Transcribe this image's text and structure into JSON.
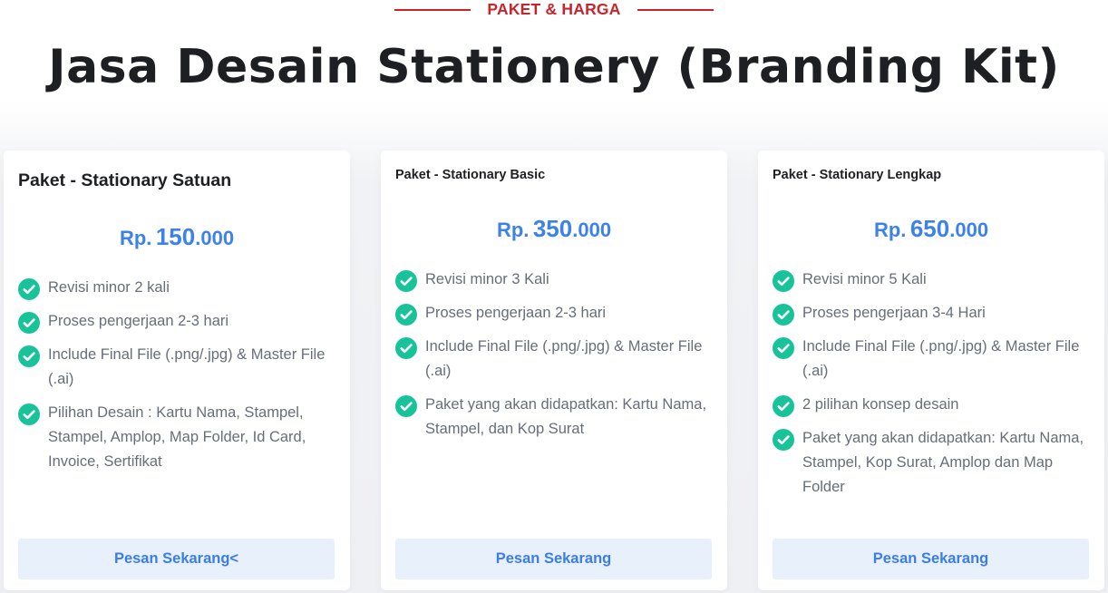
{
  "header": {
    "eyebrow": "PAKET & HARGA",
    "title": "Jasa Desain Stationery (Branding Kit)"
  },
  "colors": {
    "accent_red": "#c8252b",
    "price_blue": "#3c82ea",
    "check_green": "#19c39a",
    "button_bg": "#e8f0fc"
  },
  "icons": {
    "feature": "check-circle-icon"
  },
  "cards": [
    {
      "name": "Paket - Stationary Satuan",
      "price": {
        "currency": "Rp.",
        "main": "150",
        "tail": ".000"
      },
      "features": [
        "Revisi minor 2 kali",
        "Proses pengerjaan 2-3 hari",
        "Include Final File (.png/.jpg) & Master File (.ai)",
        "Pilihan Desain : Kartu Nama, Stampel, Stampel, Amplop, Map Folder, Id Card, Invoice, Sertifikat"
      ],
      "button": "Pesan Sekarang<"
    },
    {
      "name": "Paket - Stationary Basic",
      "price": {
        "currency": "Rp.",
        "main": "350",
        "tail": ".000"
      },
      "features": [
        "Revisi minor 3 Kali",
        "Proses pengerjaan 2-3 hari",
        "Include Final File (.png/.jpg) & Master File (.ai)",
        "Paket yang akan didapatkan: Kartu Nama, Stampel, dan Kop Surat"
      ],
      "button": "Pesan Sekarang"
    },
    {
      "name": "Paket - Stationary Lengkap",
      "price": {
        "currency": "Rp.",
        "main": "650",
        "tail": ".000"
      },
      "features": [
        "Revisi minor 5 Kali",
        "Proses pengerjaan 3-4 Hari",
        "Include Final File (.png/.jpg) & Master File (.ai)",
        "2 pilihan konsep desain",
        "Paket yang akan didapatkan: Kartu Nama, Stampel, Kop Surat, Amplop dan Map Folder"
      ],
      "button": "Pesan Sekarang"
    }
  ]
}
